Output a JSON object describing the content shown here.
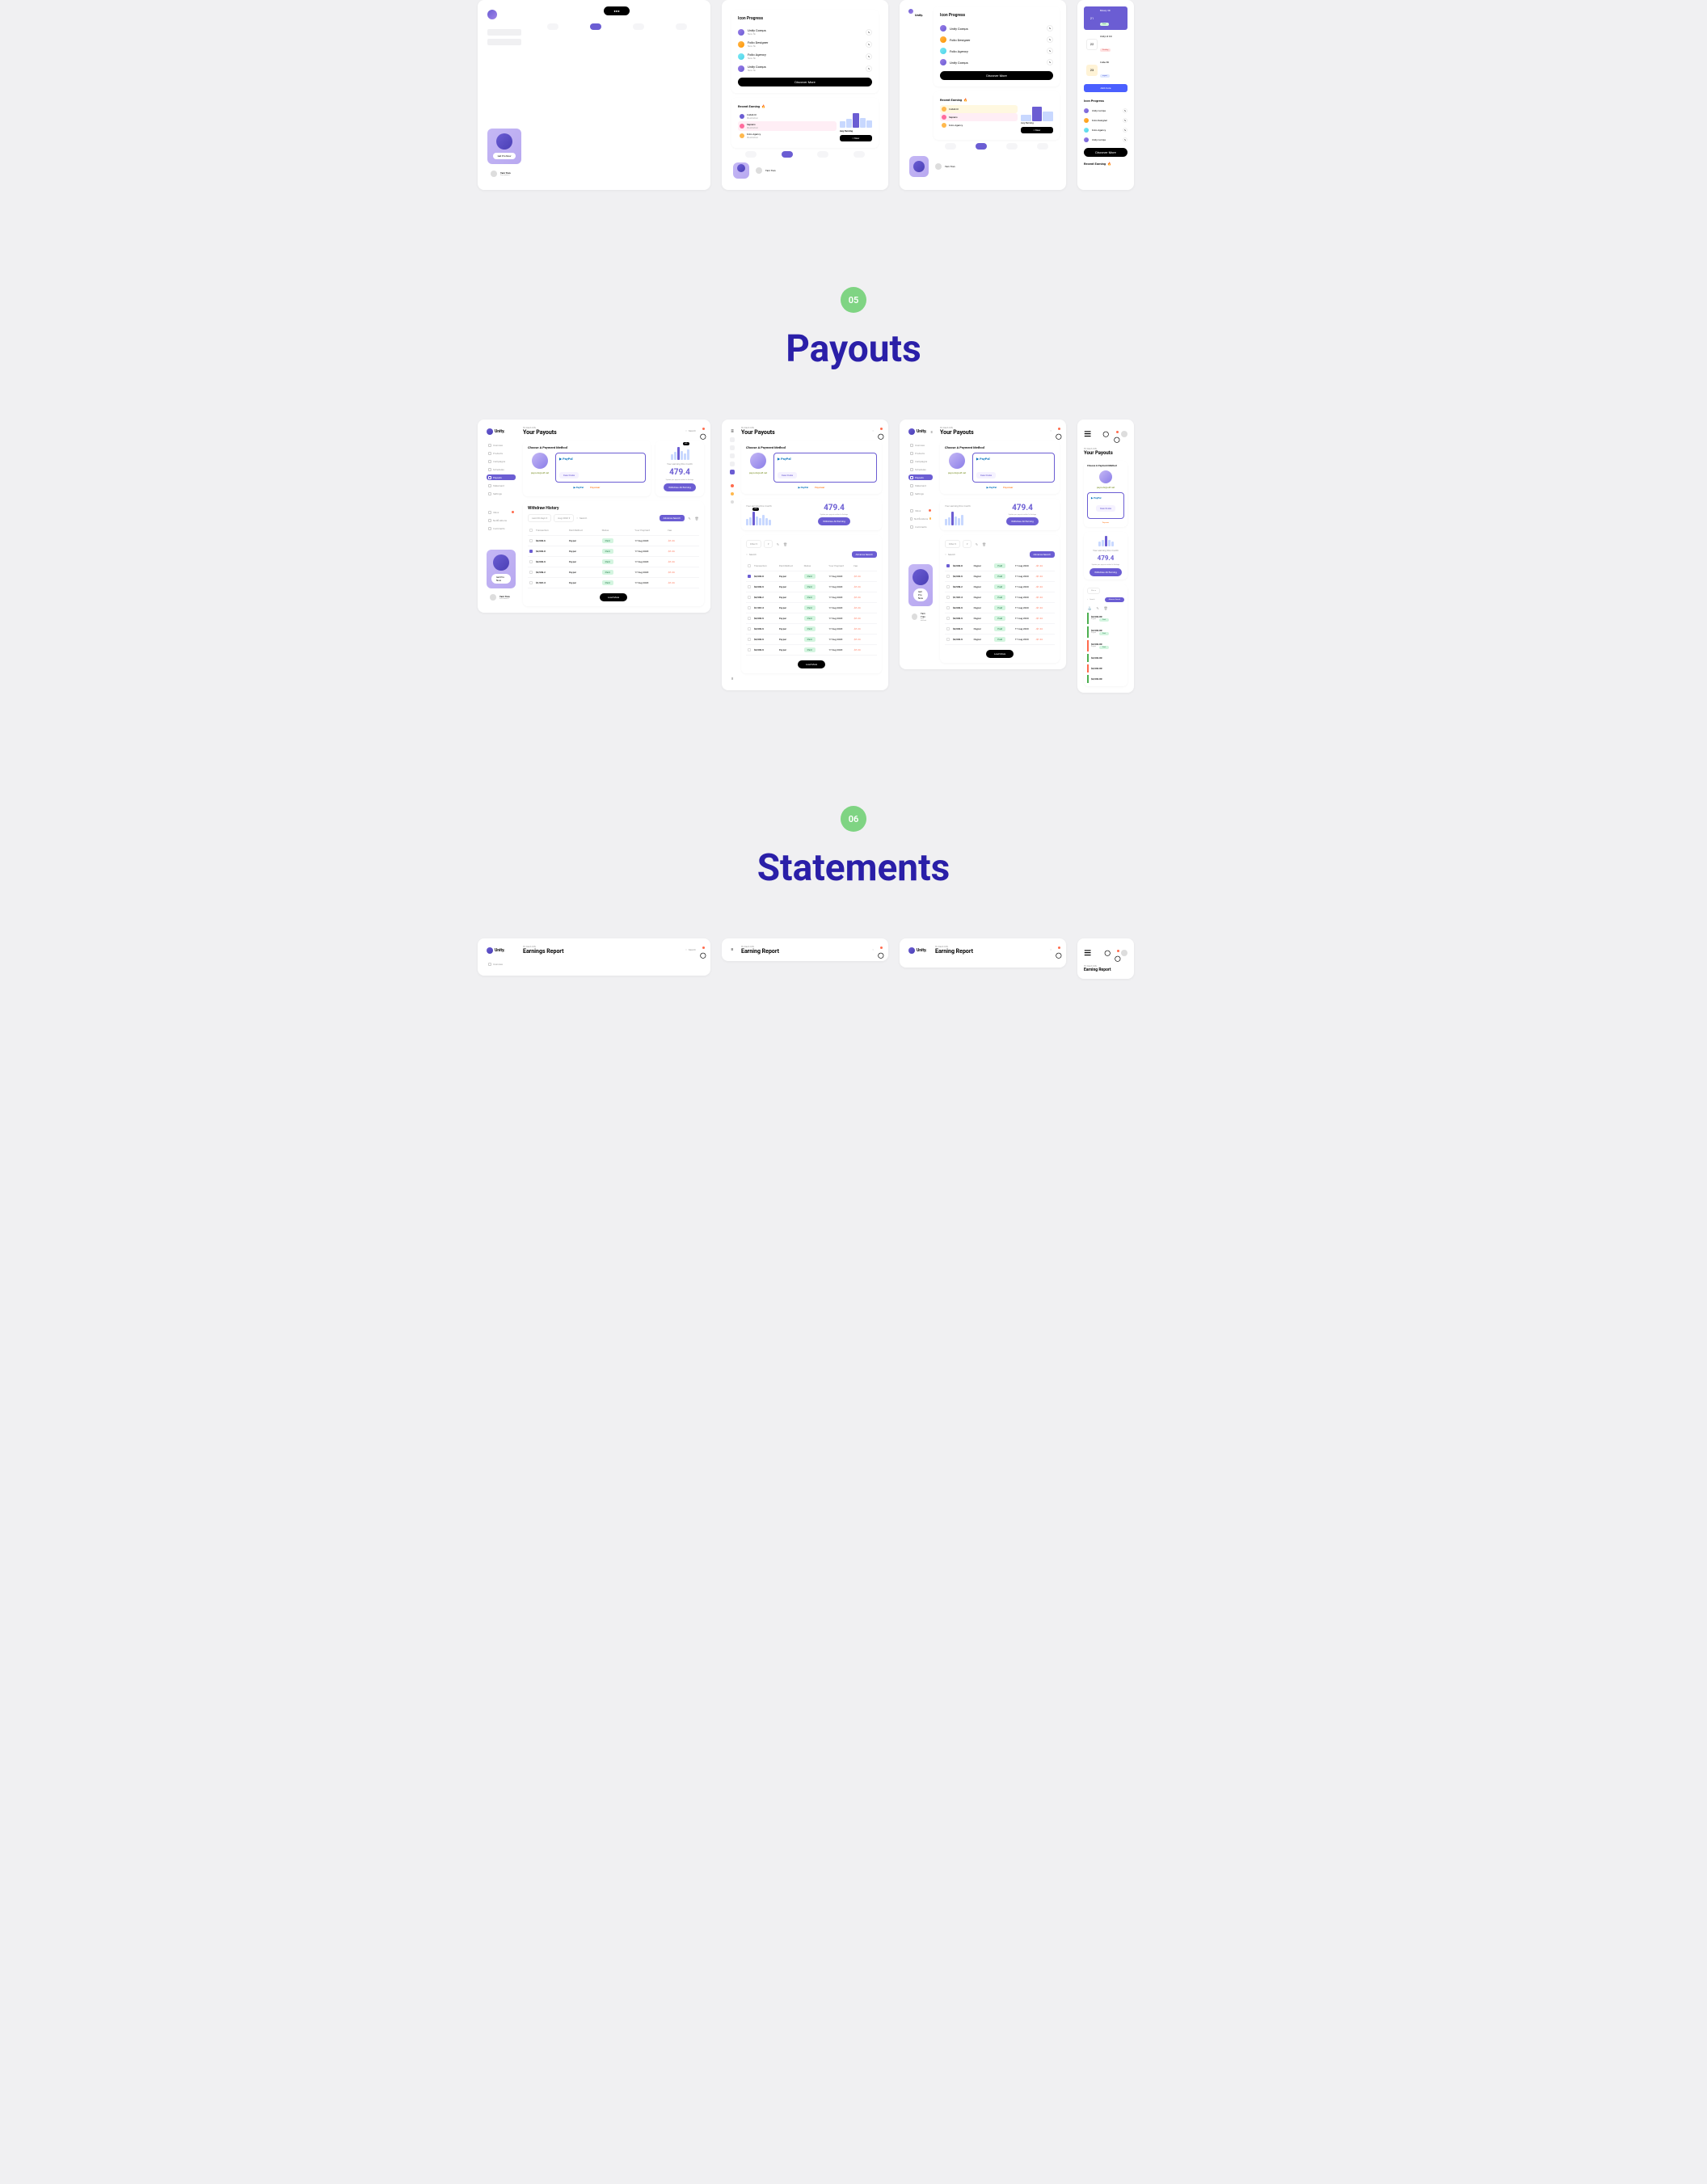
{
  "sections": {
    "payouts": {
      "badge": "05",
      "title": "Payouts"
    },
    "statements": {
      "badge": "06",
      "title": "Statements"
    }
  },
  "brand": "Unity.",
  "greeting": "Hi Dash UI8,",
  "titles": {
    "payouts": "Your Payouts",
    "earnings_report": "Earnings Report",
    "earning_report": "Earning Report"
  },
  "search_placeholder": "Search",
  "sidebar": {
    "items": [
      "Overview",
      "Products",
      "Campaigns",
      "Schedules",
      "Payouts",
      "Statement",
      "Settings"
    ],
    "bottom": [
      "Inbox",
      "Notifications",
      "Comments"
    ],
    "active": "Payouts"
  },
  "promo": {
    "btn": "Get Pro Now"
  },
  "user": {
    "name": "Tam Tran",
    "role": "Free account"
  },
  "payment": {
    "title": "Choose A Payment Method",
    "email": "payouts@ui8.net",
    "deactivate": "Deactivate",
    "paypal": "PayPal",
    "payoneer": "Payoneer"
  },
  "earning": {
    "label": "Your earning this month",
    "value": "479.4",
    "sub": "Update your payout method in Settings",
    "btn": "Withdraw All Earning",
    "badge": "+6%"
  },
  "history": {
    "title": "Withdraw History",
    "filter1": "Last 30 days",
    "filter2": "Aug 2020",
    "filter": "Filter",
    "search": "Search",
    "adv": "Advance Search",
    "headers": [
      "Transaction",
      "Paid Method",
      "Status",
      "Your Payment",
      "Fee"
    ],
    "rows": [
      {
        "amt": "$2,932.6",
        "method": "Paypal",
        "status": "Paid",
        "date": "17 Aug 2020",
        "fee": "-$1.24"
      },
      {
        "amt": "$2,932.0",
        "method": "Paypal",
        "status": "Paid",
        "date": "17 Aug 2020",
        "fee": "-$1.24",
        "checked": true
      },
      {
        "amt": "$2,932.9",
        "method": "Paypal",
        "status": "Paid",
        "date": "17 Aug 2020",
        "fee": "-$1.24"
      },
      {
        "amt": "$2,549.2",
        "method": "Paypal",
        "status": "Paid",
        "date": "17 Aug 2020",
        "fee": "-$1.24"
      },
      {
        "amt": "$1,567.3",
        "method": "Paypal",
        "status": "Paid",
        "date": "17 Aug 2020",
        "fee": "-$1.24"
      },
      {
        "amt": "$2,932.9",
        "method": "Paypal",
        "status": "Paid",
        "date": "17 Aug 2020",
        "fee": "-$1.24"
      },
      {
        "amt": "$2,932.9",
        "method": "Paypal",
        "status": "Paid",
        "date": "17 Aug 2020",
        "fee": "-$1.24"
      },
      {
        "amt": "$2,932.9",
        "method": "Paypal",
        "status": "Paid",
        "date": "17 Aug 2020",
        "fee": "-$1.24"
      },
      {
        "amt": "$2,932.9",
        "method": "Paypal",
        "status": "Paid",
        "date": "17 Aug 2020",
        "fee": "-$1.24"
      },
      {
        "amt": "$2,932.89",
        "method": "Paypal",
        "status": "Paid",
        "date": "",
        "fee": ""
      },
      {
        "amt": "$2,932.89",
        "method": "Paypal",
        "status": "Paid",
        "date": "",
        "fee": ""
      },
      {
        "amt": "$2,932.89",
        "method": "Paypal",
        "status": "Paid",
        "date": "",
        "fee": ""
      }
    ],
    "load_more": "Load More"
  },
  "top_previews": {
    "icon_progress": {
      "title": "Icon Progress",
      "items": [
        {
          "name": "Unity Comps",
          "sub": "New 5k"
        },
        {
          "name": "Folio Designer",
          "sub": "New 5k"
        },
        {
          "name": "Folio Agency",
          "sub": "New 5k"
        },
        {
          "name": "Unity Comps",
          "sub": "New 5k"
        }
      ],
      "discover": "Discover More"
    },
    "recent_earning": {
      "title": "Recent Earning",
      "fire": "🔥",
      "items": [
        {
          "name": "Collab UI",
          "sub": "Illustration"
        },
        {
          "name": "Sapiens",
          "sub": "Illustration"
        },
        {
          "name": "Folio Agency",
          "sub": "Illustration"
        }
      ],
      "avg": "Avg Earning",
      "new_btn": "New"
    },
    "calendar": {
      "items": [
        {
          "day": "21",
          "title": "Binary 3D",
          "tag": "Done"
        },
        {
          "day": "22",
          "title": "Unity UI Kit",
          "tag": "Pending"
        },
        {
          "day": "23",
          "title": "Cube 3D",
          "tag": "urgent"
        }
      ],
      "add": "Add more"
    }
  },
  "chart_data": {
    "type": "bar",
    "values": [
      40,
      55,
      90,
      60,
      45,
      70,
      50,
      35,
      25
    ],
    "highlight_index": 2,
    "badge": "+6%"
  }
}
